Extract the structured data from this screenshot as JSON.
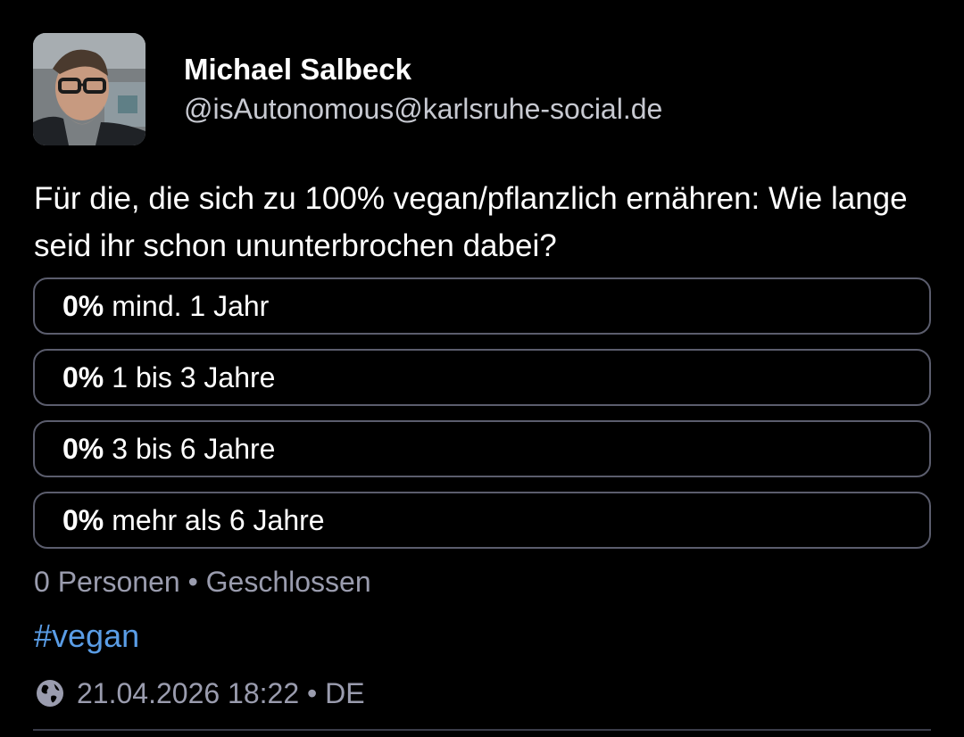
{
  "author": {
    "display_name": "Michael Salbeck",
    "handle": "@isAutonomous@karlsruhe-social.de",
    "avatar": "profile-photo"
  },
  "post": {
    "text": "Für die, die sich zu 100% vegan/pflanzlich ernähren: Wie lange seid ihr schon ununterbrochen dabei?"
  },
  "poll": {
    "options": [
      {
        "percent": "0%",
        "label": "mind. 1 Jahr"
      },
      {
        "percent": "0%",
        "label": "1 bis 3 Jahre"
      },
      {
        "percent": "0%",
        "label": "3 bis 6 Jahre"
      },
      {
        "percent": "0%",
        "label": "mehr als 6 Jahre"
      }
    ],
    "meta": "0 Personen • Geschlossen"
  },
  "hashtag": "#vegan",
  "footer": {
    "visibility_icon": "globe-icon",
    "timestamp": "21.04.2026 18:22 • DE"
  },
  "colors": {
    "background": "#000000",
    "text": "#ffffff",
    "muted": "#9a9cae",
    "border": "#5b5d6d",
    "link": "#5a9de6"
  }
}
